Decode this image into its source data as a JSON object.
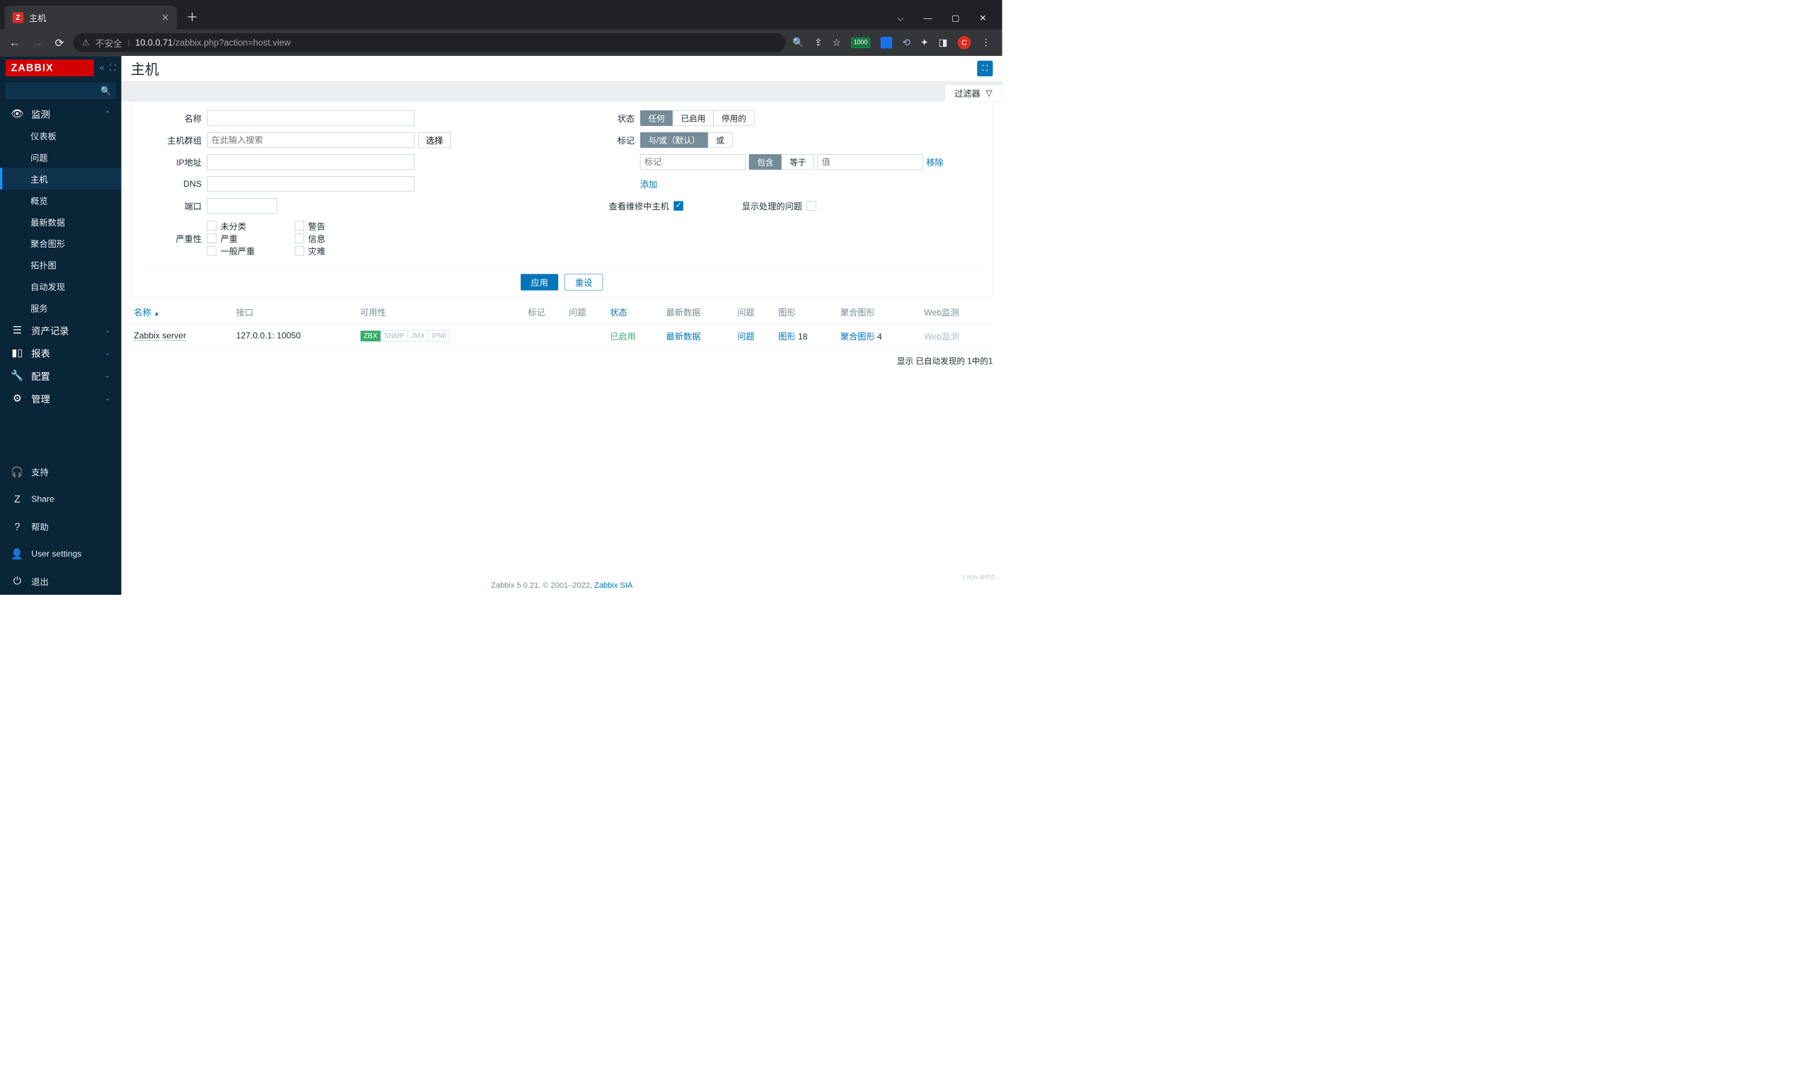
{
  "browser": {
    "tab_title": "主机",
    "tab_icon_letter": "Z",
    "url_insecure": "不安全",
    "url_host": "10.0.0.71",
    "url_path": "/zabbix.php?action=host.view",
    "ext_badge": "1000",
    "avatar": "C"
  },
  "sidebar": {
    "logo": "ZABBIX",
    "search_placeholder": "",
    "sections": {
      "monitor": "监测",
      "inventory": "资产记录",
      "reports": "报表",
      "config": "配置",
      "admin": "管理"
    },
    "monitor_items": [
      "仪表板",
      "问题",
      "主机",
      "概览",
      "最新数据",
      "聚合图形",
      "拓扑图",
      "自动发现",
      "服务"
    ],
    "bottom": {
      "support": "支持",
      "share": "Share",
      "help": "帮助",
      "user": "User settings",
      "logout": "退出"
    }
  },
  "header": {
    "title": "主机",
    "filter_tab": "过滤器"
  },
  "filter": {
    "labels": {
      "name": "名称",
      "group": "主机群组",
      "ip": "IP地址",
      "dns": "DNS",
      "port": "端口",
      "severity": "严重性",
      "status": "状态",
      "tags": "标记",
      "maint": "查看维修中主机",
      "show_sup": "显示处理的问题"
    },
    "group_placeholder": "在此输入搜索",
    "select_btn": "选择",
    "status_opts": [
      "任何",
      "已启用",
      "停用的"
    ],
    "tag_mode_opts": [
      "与/或（默认）",
      "或"
    ],
    "tag_contains": "包含",
    "tag_equals": "等于",
    "tag_key_ph": "标记",
    "tag_val_ph": "值",
    "tag_remove": "移除",
    "tag_add": "添加",
    "severity_opts": [
      "未分类",
      "警告",
      "严重",
      "信息",
      "一般严重",
      "灾难"
    ],
    "apply": "应用",
    "reset": "重设"
  },
  "table": {
    "cols": {
      "name": "名称",
      "iface": "接口",
      "avail": "可用性",
      "tags": "标记",
      "problems": "问题",
      "status": "状态",
      "latest": "最新数据",
      "col_problems": "问题",
      "graphs": "图形",
      "screens": "聚合图形",
      "web": "Web监测"
    },
    "rows": [
      {
        "name": "Zabbix server",
        "iface": "127.0.0.1: 10050",
        "avail": {
          "zbx": "ZBX",
          "snmp": "SNMP",
          "jmx": "JMX",
          "ipmi": "IPMI"
        },
        "status": "已启用",
        "latest": "最新数据",
        "problems": "问题",
        "graphs_label": "图形",
        "graphs_n": "18",
        "screens_label": "聚合图形",
        "screens_n": "4",
        "web": "Web监测"
      }
    ],
    "footer": "显示 已自动发现的 1中的1"
  },
  "footer": {
    "ver": "Zabbix 5.0.21. © 2001–2022, ",
    "company": "Zabbix SIA"
  },
  "watermark": "CSDN @约久.."
}
